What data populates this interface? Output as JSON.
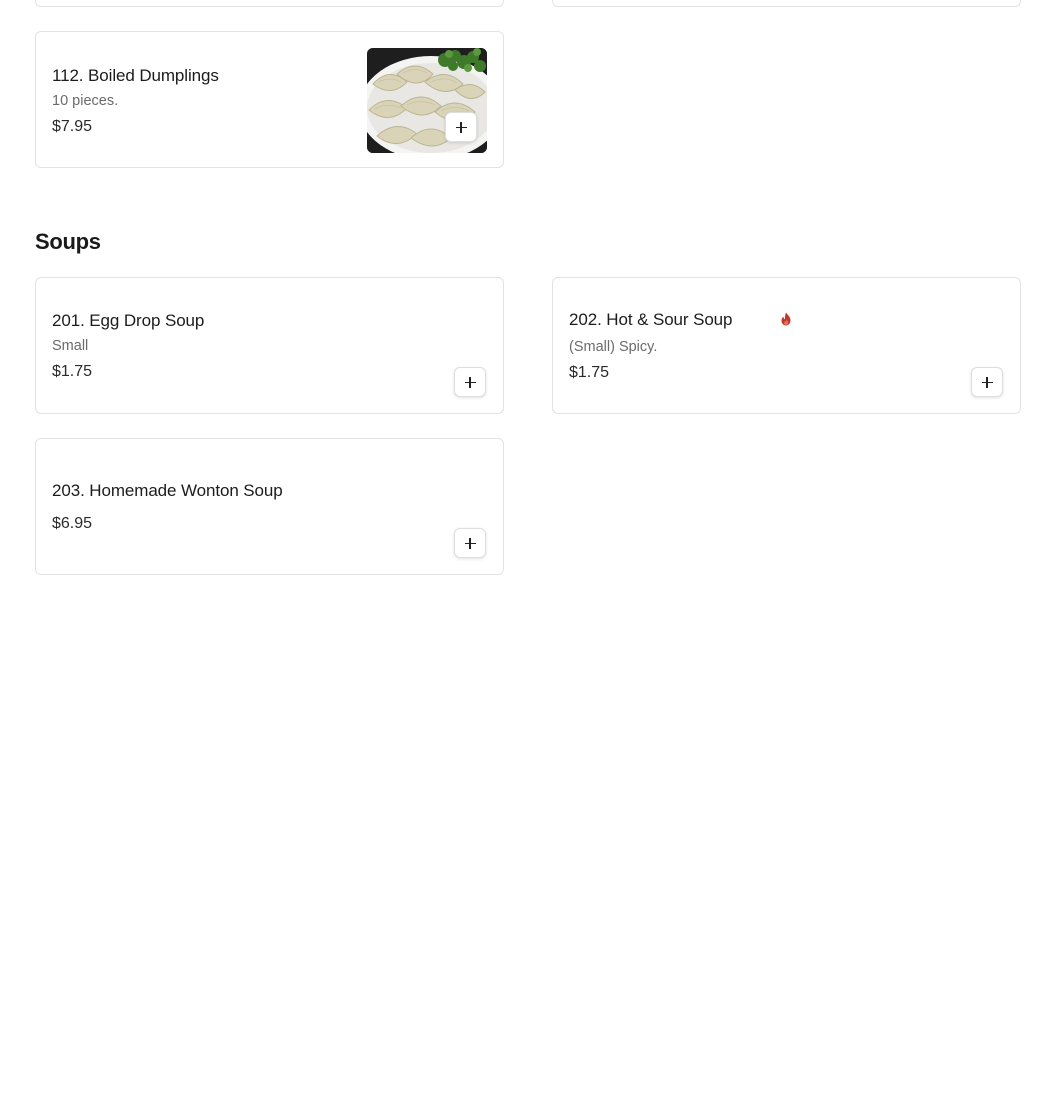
{
  "sections": {
    "soups_title": "Soups"
  },
  "items": {
    "dumplings": {
      "name": "112. Boiled Dumplings",
      "description": "10 pieces.",
      "price": "$7.95",
      "image": "dumplings-photo"
    },
    "egg_drop": {
      "name": "201. Egg Drop Soup",
      "description": "Small",
      "price": "$1.75"
    },
    "hot_sour": {
      "name": "202. Hot & Sour Soup",
      "description": "(Small) Spicy.",
      "price": "$1.75",
      "badge_icon": "spicy-flame-icon"
    },
    "wonton": {
      "name": "203. Homemade Wonton Soup",
      "price": "$6.95"
    }
  },
  "icons": {
    "add": "plus-icon",
    "spicy": "flame-icon"
  },
  "colors": {
    "card_border": "#e3e3e3",
    "spicy": "#c0392b",
    "text_primary": "#1c1c1c",
    "text_secondary": "#6b6b6b"
  }
}
